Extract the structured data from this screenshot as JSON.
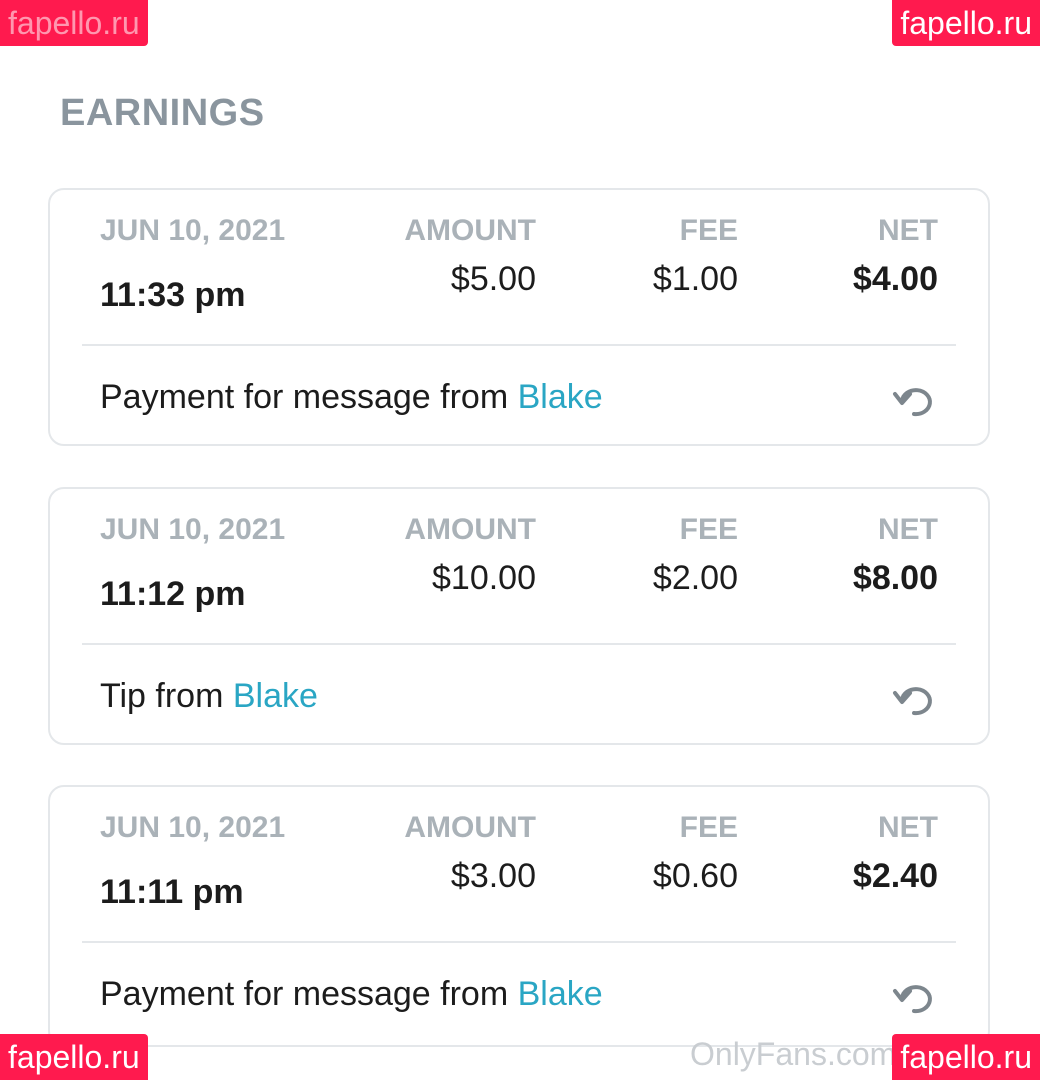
{
  "page_title": "EARNINGS",
  "headers": {
    "date": "JUN 10, 2021",
    "amount": "AMOUNT",
    "fee": "FEE",
    "net": "NET"
  },
  "transactions": [
    {
      "date": "JUN 10, 2021",
      "time": "11:33 pm",
      "amount": "$5.00",
      "fee": "$1.00",
      "net": "$4.00",
      "description": "Payment for message from",
      "user": "Blake"
    },
    {
      "date": "JUN 10, 2021",
      "time": "11:12 pm",
      "amount": "$10.00",
      "fee": "$2.00",
      "net": "$8.00",
      "description": "Tip from",
      "user": "Blake"
    },
    {
      "date": "JUN 10, 2021",
      "time": "11:11 pm",
      "amount": "$3.00",
      "fee": "$0.60",
      "net": "$2.40",
      "description": "Payment for message from",
      "user": "Blake"
    }
  ],
  "icons": {
    "refund": "undo-icon"
  },
  "colors": {
    "accent_link": "#2aa6c4",
    "badge": "#ff1a4e",
    "muted": "#aab2b8"
  },
  "overlays": {
    "watermark_badge": "fapello.ru",
    "site_watermark": "OnlyFans.com"
  }
}
